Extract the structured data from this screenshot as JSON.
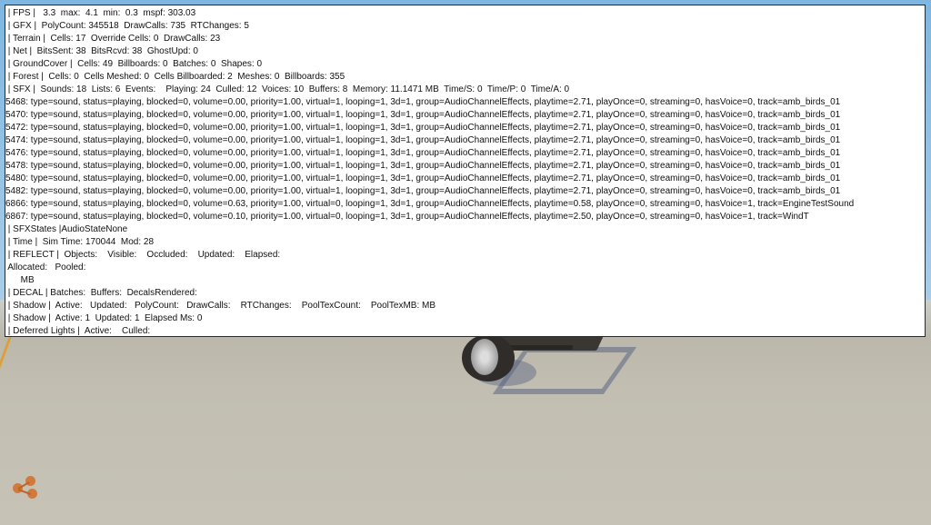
{
  "debug_lines": [
    " | FPS |   3.3  max:  4.1  min:  0.3  mspf: 303.03",
    " | GFX |  PolyCount: 345518  DrawCalls: 735  RTChanges: 5",
    " | Terrain |  Cells: 17  Override Cells: 0  DrawCalls: 23",
    " | Net |  BitsSent: 38  BitsRcvd: 38  GhostUpd: 0",
    " | GroundCover |  Cells: 49  Billboards: 0  Batches: 0  Shapes: 0",
    " | Forest |  Cells: 0  Cells Meshed: 0  Cells Billboarded: 2  Meshes: 0  Billboards: 355",
    " | SFX |  Sounds: 18  Lists: 6  Events:    Playing: 24  Culled: 12  Voices: 10  Buffers: 8  Memory: 11.1471 MB  Time/S: 0  Time/P: 0  Time/A: 0",
    "5468: type=sound, status=playing, blocked=0, volume=0.00, priority=1.00, virtual=1, looping=1, 3d=1, group=AudioChannelEffects, playtime=2.71, playOnce=0, streaming=0, hasVoice=0, track=amb_birds_01",
    "5470: type=sound, status=playing, blocked=0, volume=0.00, priority=1.00, virtual=1, looping=1, 3d=1, group=AudioChannelEffects, playtime=2.71, playOnce=0, streaming=0, hasVoice=0, track=amb_birds_01",
    "5472: type=sound, status=playing, blocked=0, volume=0.00, priority=1.00, virtual=1, looping=1, 3d=1, group=AudioChannelEffects, playtime=2.71, playOnce=0, streaming=0, hasVoice=0, track=amb_birds_01",
    "5474: type=sound, status=playing, blocked=0, volume=0.00, priority=1.00, virtual=1, looping=1, 3d=1, group=AudioChannelEffects, playtime=2.71, playOnce=0, streaming=0, hasVoice=0, track=amb_birds_01",
    "5476: type=sound, status=playing, blocked=0, volume=0.00, priority=1.00, virtual=1, looping=1, 3d=1, group=AudioChannelEffects, playtime=2.71, playOnce=0, streaming=0, hasVoice=0, track=amb_birds_01",
    "5478: type=sound, status=playing, blocked=0, volume=0.00, priority=1.00, virtual=1, looping=1, 3d=1, group=AudioChannelEffects, playtime=2.71, playOnce=0, streaming=0, hasVoice=0, track=amb_birds_01",
    "5480: type=sound, status=playing, blocked=0, volume=0.00, priority=1.00, virtual=1, looping=1, 3d=1, group=AudioChannelEffects, playtime=2.71, playOnce=0, streaming=0, hasVoice=0, track=amb_birds_01",
    "5482: type=sound, status=playing, blocked=0, volume=0.00, priority=1.00, virtual=1, looping=1, 3d=1, group=AudioChannelEffects, playtime=2.71, playOnce=0, streaming=0, hasVoice=0, track=amb_birds_01",
    "6866: type=sound, status=playing, blocked=0, volume=0.63, priority=1.00, virtual=0, looping=1, 3d=1, group=AudioChannelEffects, playtime=0.58, playOnce=0, streaming=0, hasVoice=1, track=EngineTestSound",
    "6867: type=sound, status=playing, blocked=0, volume=0.10, priority=1.00, virtual=0, looping=1, 3d=1, group=AudioChannelEffects, playtime=2.50, playOnce=0, streaming=0, hasVoice=1, track=WindT",
    " | SFXStates |AudioStateNone",
    " | Time |  Sim Time: 170044  Mod: 28",
    " | REFLECT |  Objects:    Visible:    Occluded:    Updated:    Elapsed:",
    " Allocated:   Pooled:",
    "      MB",
    " | DECAL | Batches:  Buffers:  DecalsRendered:",
    " | Shadow |  Active:   Updated:   PolyCount:   DrawCalls:    RTChanges:    PoolTexCount:    PoolTexMB: MB",
    " | Shadow |  Active: 1  Updated: 1  Elapsed Ms: 0",
    " | Deferred Lights |  Active:    Culled:"
  ],
  "colors": {
    "panel_bg": "#ffffff",
    "panel_text": "#111111",
    "ground": "#c2bfb2",
    "sky": "#a9cde8",
    "gizmo": "#d27a3e"
  }
}
